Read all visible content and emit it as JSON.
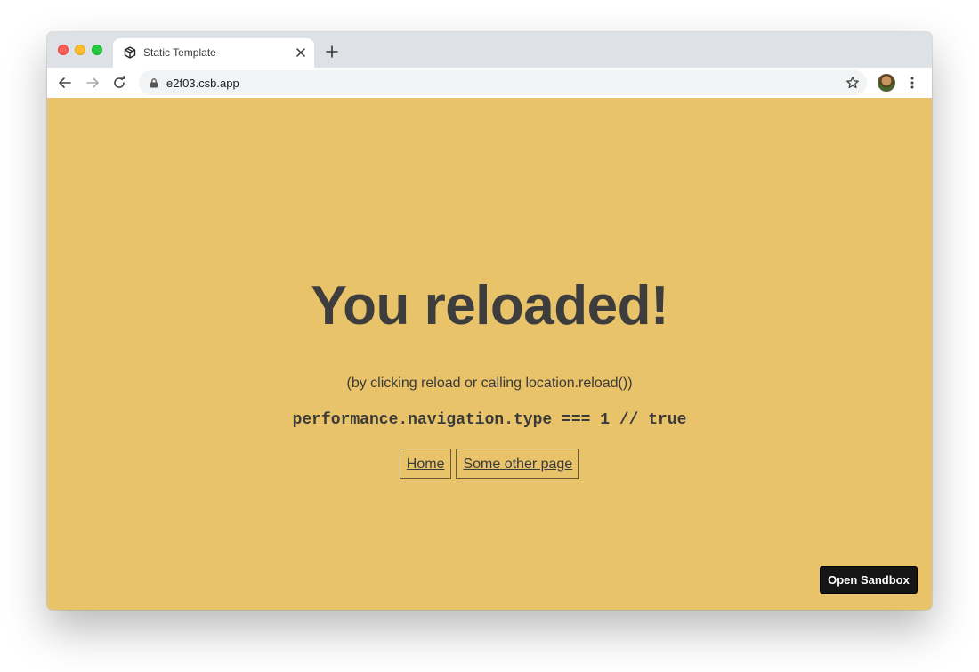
{
  "browser": {
    "tab": {
      "title": "Static Template",
      "favicon_icon": "codesandbox-cube-icon"
    },
    "address_bar": {
      "url": "e2f03.csb.app",
      "lock_icon": "lock-icon"
    },
    "colors": {
      "tabstrip": "#dee1e6",
      "toolbar": "#ffffff",
      "omnibox": "#f1f3f4"
    }
  },
  "page": {
    "background_color": "#e8c36a",
    "headline": "You reloaded!",
    "subtitle": "(by clicking reload or calling location.reload())",
    "code_line": "performance.navigation.type === 1 // true",
    "links": [
      {
        "label": "Home"
      },
      {
        "label": "Some other page"
      }
    ],
    "open_sandbox_label": "Open Sandbox"
  }
}
